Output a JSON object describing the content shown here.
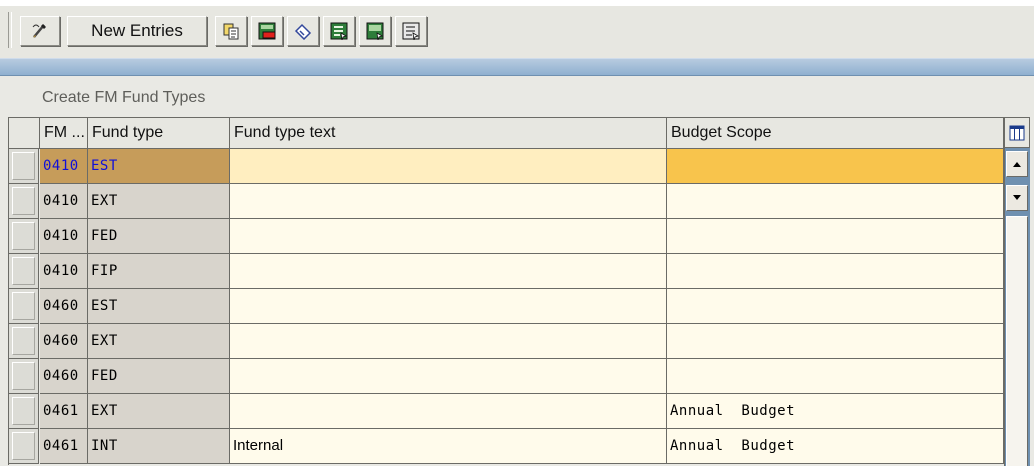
{
  "toolbar": {
    "new_entries_label": "New Entries",
    "icons": [
      "display-change-icon",
      "copy-icon",
      "delete-icon",
      "undo-icon",
      "select-all-icon",
      "select-block-icon",
      "deselect-all-icon"
    ]
  },
  "section": {
    "title": "Create FM Fund Types"
  },
  "table": {
    "columns": [
      "FM ...",
      "Fund type",
      "Fund type text",
      "Budget Scope"
    ],
    "rows": [
      {
        "fm": "0410",
        "fund_type": "EST",
        "text": "",
        "scope": "",
        "selected": true
      },
      {
        "fm": "0410",
        "fund_type": "EXT",
        "text": "",
        "scope": ""
      },
      {
        "fm": "0410",
        "fund_type": "FED",
        "text": "",
        "scope": ""
      },
      {
        "fm": "0410",
        "fund_type": "FIP",
        "text": "",
        "scope": ""
      },
      {
        "fm": "0460",
        "fund_type": "EST",
        "text": "",
        "scope": ""
      },
      {
        "fm": "0460",
        "fund_type": "EXT",
        "text": "",
        "scope": ""
      },
      {
        "fm": "0460",
        "fund_type": "FED",
        "text": "",
        "scope": ""
      },
      {
        "fm": "0461",
        "fund_type": "EXT",
        "text": "",
        "scope": "Annual  Budget"
      },
      {
        "fm": "0461",
        "fund_type": "INT",
        "text": "Internal",
        "scope": "Annual  Budget"
      }
    ]
  },
  "colors": {
    "selected_key": "#c69c5a",
    "selected_scope": "#f8c44c",
    "input_bg": "#fffbeb",
    "scroll_track": "#6f90b0"
  }
}
